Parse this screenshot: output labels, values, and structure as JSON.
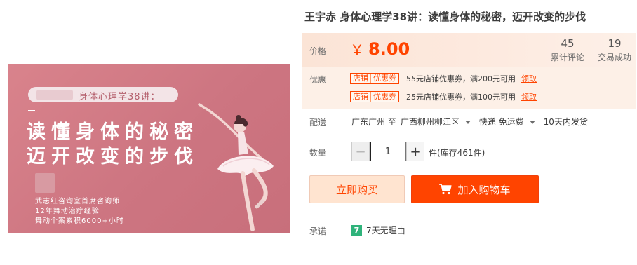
{
  "product_image": {
    "subtitle": "身体心理学38讲：",
    "headline_line1": "读懂身体的秘密",
    "headline_line2": "迈开改变的步伐",
    "credit_lines": [
      "武志红咨询室首席咨询师",
      "12年舞动治疗经验",
      "舞动个案累积6000+小时"
    ]
  },
  "title": "王宇赤 身体心理学38讲：读懂身体的秘密，迈开改变的步伐",
  "price": {
    "label": "价格",
    "currency": "￥",
    "amount": "8.00",
    "reviews_count": "45",
    "reviews_label": "累计评论",
    "deals_count": "19",
    "deals_label": "交易成功"
  },
  "promotions": {
    "label": "优惠",
    "coupons": [
      {
        "tag_left": "店铺",
        "tag_right": "优惠券",
        "desc": "55元店铺优惠券，满200元可用",
        "action": "领取"
      },
      {
        "tag_left": "店铺",
        "tag_right": "优惠券",
        "desc": "25元店铺优惠券，满100元可用",
        "action": "领取"
      }
    ]
  },
  "delivery": {
    "label": "配送",
    "from": "广东广州 至",
    "region": "广西柳州柳江区",
    "shipping": "快递 免运费",
    "dispatch": "10天内发货"
  },
  "quantity": {
    "label": "数量",
    "minus": "−",
    "value": "1",
    "plus": "+",
    "stock": "件(库存461件)"
  },
  "actions": {
    "buy_now": "立即购买",
    "add_to_cart": "加入购物车"
  },
  "promise": {
    "label": "承诺",
    "badge": "7",
    "text": "7天无理由"
  },
  "colors": {
    "accent": "#ff4400",
    "price_bg": "#fdf0e7",
    "buy_bg": "#ffe4d0",
    "badge_green": "#2fb37b",
    "image_pink": "#d07a85"
  }
}
